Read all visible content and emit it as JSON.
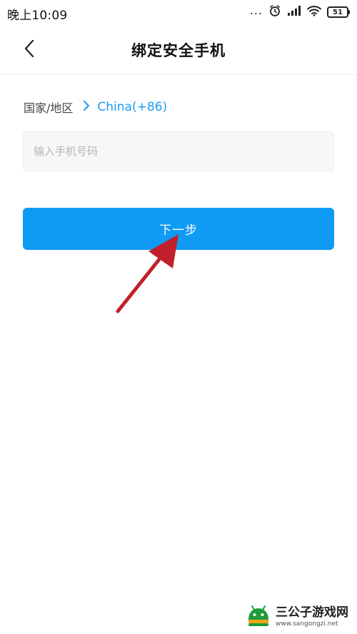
{
  "status_bar": {
    "time": "晚上10:09",
    "dots": "...",
    "battery": "51"
  },
  "header": {
    "title": "绑定安全手机",
    "back_icon": "chevron-left-icon"
  },
  "region": {
    "label": "国家/地区",
    "value": "China(+86)",
    "chevron_icon": "chevron-right-icon"
  },
  "phone_input": {
    "placeholder": "输入手机号码",
    "value": ""
  },
  "next_button": {
    "label": "下一步"
  },
  "watermark": {
    "title": "三公子游戏网",
    "url": "www.sangongzi.net"
  },
  "colors": {
    "accent": "#0f9af4",
    "link": "#1a9cf0",
    "annotation": "#c0202a"
  }
}
